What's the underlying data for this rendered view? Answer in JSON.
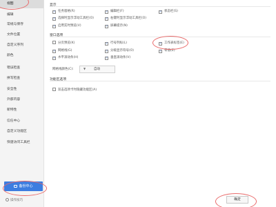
{
  "sidebar": {
    "items": [
      {
        "label": "视图",
        "active": true
      },
      {
        "label": "编辑"
      },
      {
        "label": "常规与保存"
      },
      {
        "label": "文件位置"
      },
      {
        "label": "自定义序列"
      },
      {
        "label": "颜色"
      },
      {
        "label": "错误检查"
      },
      {
        "label": "拼写检查"
      },
      {
        "label": "安全性"
      },
      {
        "label": "外部内容"
      },
      {
        "label": "新特性"
      },
      {
        "label": "信任中心"
      },
      {
        "label": "自定义功能区"
      },
      {
        "label": "快速访问工具栏"
      }
    ],
    "backup_label": "备份中心",
    "tips_label": "操作技巧"
  },
  "sections": {
    "display": {
      "title": "显示",
      "options": [
        {
          "label": "任务窗格(R)",
          "checked": true
        },
        {
          "label": "编辑栏(F)",
          "checked": true
        },
        {
          "label": "状态栏(S)",
          "checked": true
        },
        {
          "label": "选择时显示浮动工具栏(O)",
          "checked": true
        },
        {
          "label": "右键时显示浮动工具栏(O)",
          "checked": true
        },
        {
          "label": "启用实时预览(V)",
          "checked": true
        },
        {
          "label": "屏幕提示(N)",
          "checked": true
        }
      ]
    },
    "window": {
      "title": "窗口选项",
      "options": [
        {
          "label": "分页预览(K)",
          "checked": false
        },
        {
          "label": "行号列标(L)",
          "checked": true
        },
        {
          "label": "工作表标签(E)",
          "checked": true
        },
        {
          "label": "网格线(G)",
          "checked": true
        },
        {
          "label": "分级显示符号(O)",
          "checked": true
        },
        {
          "label": "零值(Z)",
          "checked": true
        },
        {
          "label": "水平滚动条(H)",
          "checked": true
        },
        {
          "label": "垂直滚动条(V)",
          "checked": true
        }
      ],
      "gridline_color_label": "网格线颜色(C):",
      "gridline_color_value": "自动"
    },
    "ribbon": {
      "title": "功能区选项",
      "options": [
        {
          "label": "双击选项卡时隐藏功能区(A)",
          "checked": false
        }
      ]
    }
  },
  "footer": {
    "confirm_label": "确定"
  },
  "colors": {
    "accent": "#3d7de0",
    "annotation": "#e96b6b"
  }
}
